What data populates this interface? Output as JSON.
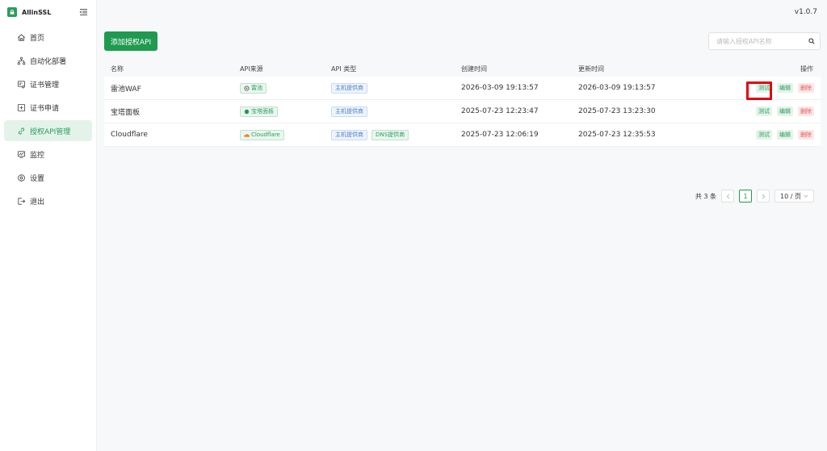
{
  "app": {
    "name": "AllinSSL",
    "version": "v1.0.7"
  },
  "sidebar": {
    "items": [
      {
        "label": "首页",
        "icon": "home-icon"
      },
      {
        "label": "自动化部署",
        "icon": "workflow-icon"
      },
      {
        "label": "证书管理",
        "icon": "certificate-icon"
      },
      {
        "label": "证书申请",
        "icon": "apply-icon"
      },
      {
        "label": "授权API管理",
        "icon": "link-icon",
        "active": true
      },
      {
        "label": "监控",
        "icon": "monitor-icon"
      },
      {
        "label": "设置",
        "icon": "gear-icon"
      },
      {
        "label": "退出",
        "icon": "logout-icon"
      }
    ]
  },
  "toolbar": {
    "add_label": "添加授权API",
    "search_placeholder": "请输入授权API名称"
  },
  "table": {
    "headers": {
      "name": "名称",
      "source": "API来源",
      "type": "API 类型",
      "created": "创建时间",
      "updated": "更新时间",
      "actions": "操作"
    },
    "rows": [
      {
        "name": "雷池WAF",
        "source": "雷池",
        "source_icon": "safeline-icon",
        "types": [
          "主机提供商"
        ],
        "created": "2026-03-09 19:13:57",
        "updated": "2026-03-09 19:13:57"
      },
      {
        "name": "宝塔面板",
        "source": "宝塔面板",
        "source_icon": "btpanel-icon",
        "types": [
          "主机提供商"
        ],
        "created": "2025-07-23 12:23:47",
        "updated": "2025-07-23 13:23:30"
      },
      {
        "name": "Cloudflare",
        "source": "Cloudflare",
        "source_icon": "cloudflare-icon",
        "types": [
          "主机提供商",
          "DNS提供商"
        ],
        "created": "2025-07-23 12:06:19",
        "updated": "2025-07-23 12:35:53"
      }
    ],
    "actions": {
      "test": "测试",
      "edit": "编辑",
      "delete": "删除"
    }
  },
  "pagination": {
    "total": "共 3 条",
    "current_page": "1",
    "page_size": "10 / 页"
  },
  "colors": {
    "accent": "#1f9a4f",
    "danger": "#e05a5a",
    "highlight": "#e8000b"
  }
}
